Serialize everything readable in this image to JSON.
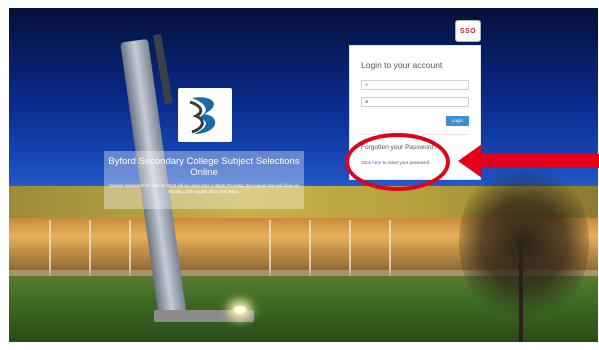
{
  "badge": {
    "text": "SSO",
    "color": "#d21f1f"
  },
  "school": {
    "title": "Byford Secondary College Subject Selections Online",
    "notice": "Subject selections for Year 11 2018 will be open from 4:30pm Thursday 3rd August and will close on Monday 14th August 2017 at 6:00pm."
  },
  "login": {
    "heading": "Login to your account",
    "username_icon": "user-icon",
    "password_icon": "lock-icon",
    "button_label": "Login",
    "button_color": "#3d8fd6"
  },
  "forgot": {
    "heading": "Forgotten your Password?",
    "prefix": "Click",
    "link": "here",
    "suffix": "to reset your password."
  },
  "annotation": {
    "color": "#e3001b"
  }
}
